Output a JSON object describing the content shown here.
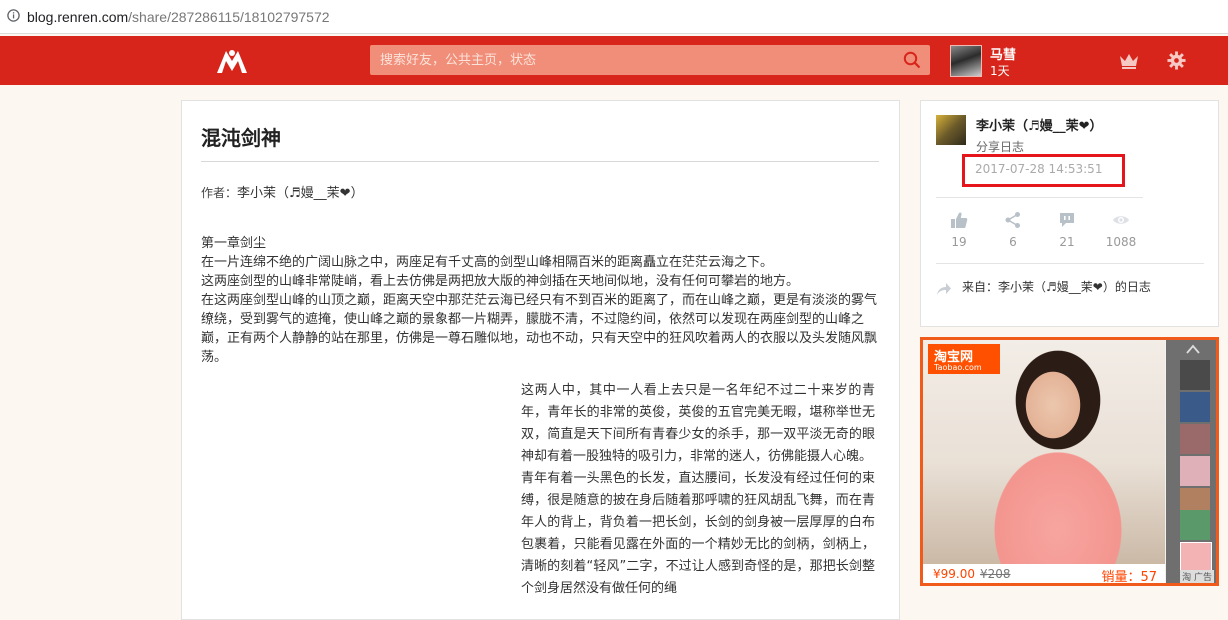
{
  "browser": {
    "url_host": "blog.renren.com",
    "url_path": "/share/287286115/18102797572",
    "info_icon": "info-icon"
  },
  "header": {
    "logo_icon": "renren-logo-icon",
    "search_placeholder": "搜索好友，公共主页，状态",
    "user_name": "马彗",
    "user_days": "1天",
    "accent": "#d8251b"
  },
  "article": {
    "title": "混沌剑神",
    "author_label": "作者：",
    "author_name": "李小茉（♬嫚__茉❤）",
    "paragraphs_top": [
      "第一章剑尘",
      "在一片连绵不绝的广阔山脉之中，两座足有千丈高的剑型山峰相隔百米的距离矗立在茫茫云海之下。",
      "这两座剑型的山峰非常陡峭，看上去仿佛是两把放大版的神剑插在天地间似地，没有任何可攀岩的地方。",
      "在这两座剑型山峰的山顶之巅，距离天空中那茫茫云海已经只有不到百米的距离了，而在山峰之巅，更是有淡淡的雾气缭绕，受到雾气的遮掩，使山峰之巅的景象都一片糊弄，朦胧不清，不过隐约间，依然可以发现在两座剑型的山峰之巅，正有两个人静静的站在那里，仿佛是一尊石雕似地，动也不动，只有天空中的狂风吹着两人的衣服以及头发随风飘荡。"
    ],
    "paragraphs_right": [
      "这两人中，其中一人看上去只是一名年纪不过二十来岁的青年，青年长的非常的英俊，英俊的五官完美无暇，堪称举世无双，简直是天下间所有青春少女的杀手，那一双平淡无奇的眼神却有着一股独特的吸引力，非常的迷人，彷佛能摄人心魄。",
      "青年有着一头黑色的长发，直达腰间，长发没有经过任何的束缚，很是随意的披在身后随着那呼啸的狂风胡乱飞舞，而在青年人的背上，背负着一把长剑，长剑的剑身被一层厚厚的白布包裹着，只能看见露在外面的一个精妙无比的剑柄，剑柄上，清晰的刻着“轻风”二字，不过让人感到奇怪的是，那把长剑整个剑身居然没有做任何的绳"
    ]
  },
  "side": {
    "owner": "李小茉（♬嫚__茉❤）",
    "kind": "分享日志",
    "date": "2017-07-28 14:53:51",
    "highlight_color": "#e6141b",
    "stats": [
      {
        "icon": "thumbs-up-icon",
        "value": "19"
      },
      {
        "icon": "share-icon",
        "value": "6"
      },
      {
        "icon": "comment-icon",
        "value": "21"
      },
      {
        "icon": "eye-icon",
        "value": "1088"
      }
    ],
    "from_icon": "share-arrow-icon",
    "from_text": "来自：李小茉（♬嫚__茉❤）的日志"
  },
  "ad": {
    "brand": "淘宝网",
    "brand_domain": "Taobao.com",
    "price": "¥99.00",
    "old_price": "¥208",
    "sold": "销量：57",
    "tag": "淘 广告",
    "border_color": "#f05a1a"
  }
}
